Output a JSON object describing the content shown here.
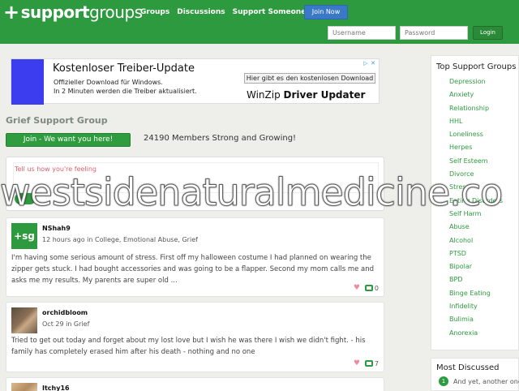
{
  "header": {
    "logo_bold": "support",
    "logo_normal": "groups",
    "nav": [
      "Groups",
      "Discussions",
      "Support Someone"
    ],
    "join_label": "Join Now",
    "username_placeholder": "Username",
    "password_placeholder": "Password",
    "login_label": "Login",
    "accent_color": "#2e9a3f"
  },
  "ad": {
    "title": "Kostenloser Treiber-Update",
    "line1": "Offizieller Download für Windows.",
    "line2": "In 2 Minuten werden die Treiber aktualisiert.",
    "button": "Hier gibt es den kostenlosen Download",
    "brand_prefix": "WinZip",
    "brand_bold": "Driver Updater"
  },
  "group": {
    "title": "Grief Support Group",
    "join_label": "Join - We want you here!",
    "members_text": "24190 Members Strong and Growing!"
  },
  "compose": {
    "placeholder": "Tell us how you're feeling"
  },
  "posts": [
    {
      "avatar_text": "+sg",
      "username": "NShah9",
      "meta": "12 hours ago in College, Emotional Abuse, Grief",
      "body": "I'm having some serious amount of stress. First off my halloween costume I had planned on wearing the zipper gets stuck. I had bought accessories and was going to be a flapper. Second my mom calls me and asks me my results. My parents are super old ...",
      "comments": "0"
    },
    {
      "username": "orchidbloom",
      "meta": "Oct 29 in Grief",
      "body": "Tried to get out today and forget about my lost love but I wish he was there I wish we didn't fight. - his family has completely erased him after his death - nothing and no one",
      "comments": "7"
    },
    {
      "username": "Itchy16"
    }
  ],
  "sidebar": {
    "title": "Top Support Groups",
    "items": [
      "Depression",
      "Anxiety",
      "Relationship",
      "HHL",
      "Loneliness",
      "Herpes",
      "Self Esteem",
      "Divorce",
      "Stress",
      "Eating Disorders",
      "Self Harm",
      "Abuse",
      "Alcohol",
      "PTSD",
      "Bipolar",
      "BPD",
      "Binge Eating",
      "Infidelity",
      "Bulimia",
      "Anorexia"
    ]
  },
  "most_discussed": {
    "title": "Most Discussed",
    "items": [
      {
        "num": "1",
        "text": "And yet, another one"
      }
    ]
  },
  "watermark": "westsidenaturalmedicine.co"
}
